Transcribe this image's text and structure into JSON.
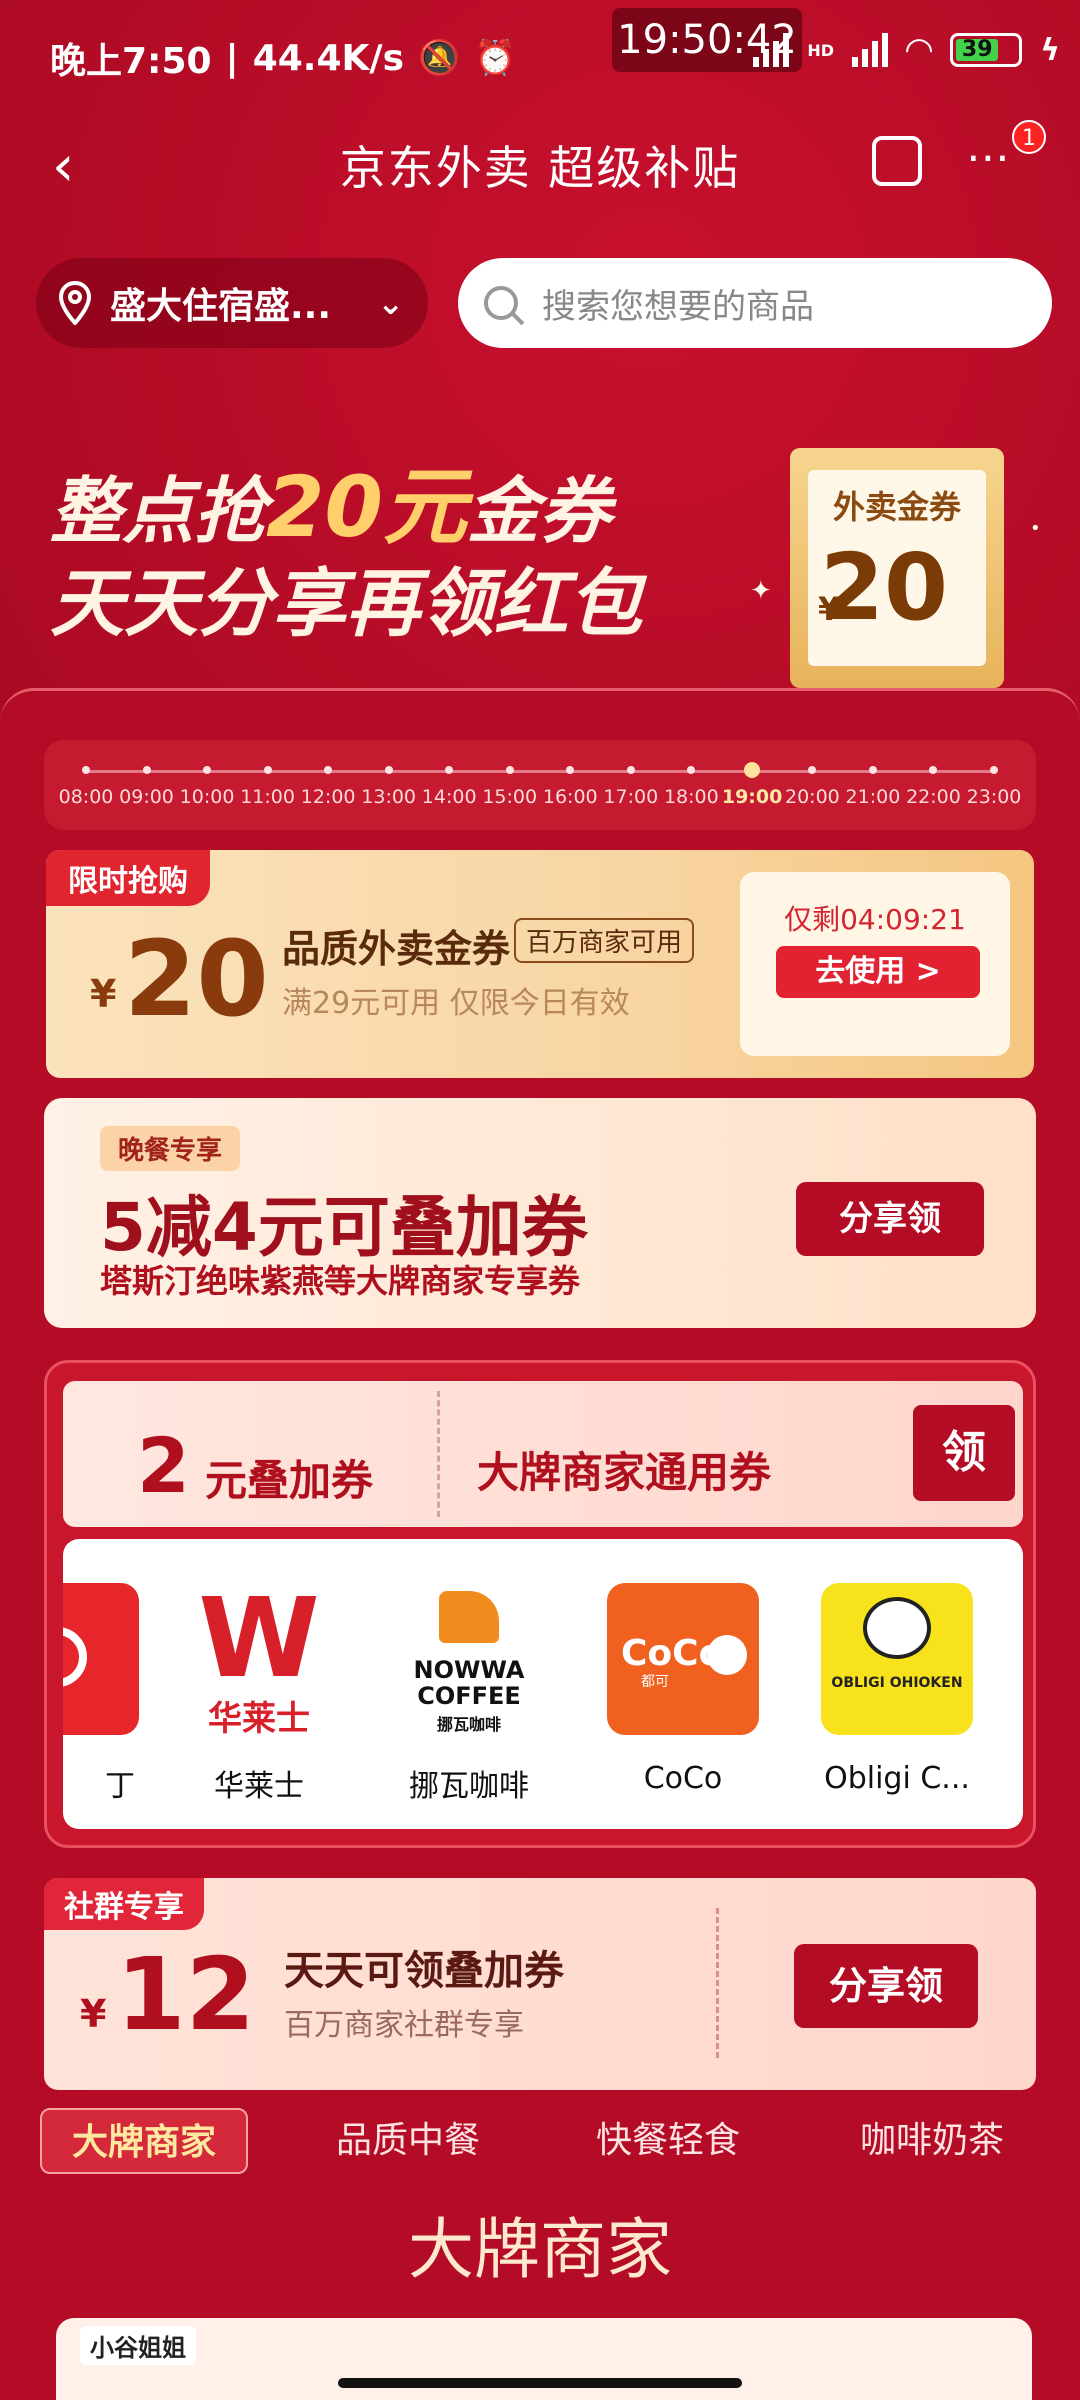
{
  "status_bar": {
    "time_left": "晚上7:50",
    "speed": "44.4K/s",
    "clock": "19:50:42",
    "hd": "HD",
    "battery": "39"
  },
  "nav": {
    "back_icon": "‹",
    "title": "京东外卖 超级补贴",
    "more_icon": "⋯",
    "badge": "1"
  },
  "location": {
    "text": "盛大住宿盛...",
    "chevron": "⌄"
  },
  "search": {
    "placeholder": "搜索您想要的商品"
  },
  "hero": {
    "line1_pre": "整点抢",
    "line1_gold": "20元",
    "line1_post": "金券",
    "line2": "天天分享再领红包",
    "card_title": "外卖金券",
    "card_currency": "¥",
    "card_value": "20"
  },
  "timeline": {
    "ticks": [
      "08:00",
      "09:00",
      "10:00",
      "11:00",
      "12:00",
      "13:00",
      "14:00",
      "15:00",
      "16:00",
      "17:00",
      "18:00",
      "19:00",
      "20:00",
      "21:00",
      "22:00",
      "23:00"
    ],
    "active_index": 11
  },
  "coupon1": {
    "tag": "限时抢购",
    "currency": "¥",
    "value": "20",
    "name": "品质外卖金券",
    "pill": "百万商家可用",
    "condition": "满29元可用 仅限今日有效",
    "remaining": "仅剩04:09:21",
    "use_button": "去使用 >"
  },
  "coupon2": {
    "tag": "晚餐专享",
    "main": "5减4元可叠加券",
    "sub": "塔斯汀绝味紫燕等大牌商家专享券",
    "button": "分享领"
  },
  "stack_coupon": {
    "amount": "2",
    "amount_label": "元叠加券",
    "universal": "大牌商家通用券",
    "button": "领"
  },
  "brands": [
    {
      "name": "丁",
      "icon": "tastien-logo"
    },
    {
      "name": "华莱士",
      "icon": "wallace-logo"
    },
    {
      "name": "挪瓦咖啡",
      "icon": "nowwa-logo"
    },
    {
      "name": "CoCo",
      "icon": "coco-logo"
    },
    {
      "name": "Obligi C...",
      "icon": "obligi-logo"
    }
  ],
  "brand_logo_text": {
    "wallace_cn": "华莱士",
    "nowwa1": "NOWWA",
    "nowwa2": "COFFEE",
    "nowwa3": "挪瓦咖啡",
    "coco": "CoCo",
    "coco_cn": "都可",
    "obligi": "OBLIGI OHIOKEN"
  },
  "coupon3": {
    "tag": "社群专享",
    "currency": "¥",
    "value": "12",
    "title": "天天可领叠加券",
    "subtitle": "百万商家社群专享",
    "button": "分享领"
  },
  "tabs": [
    "大牌商家",
    "品质中餐",
    "快餐轻食",
    "咖啡奶茶"
  ],
  "section_title": "大牌商家",
  "watermark": "小谷姐姐",
  "colors": {
    "background": "#a4081f",
    "gold": "#ffcf6b",
    "accent_red": "#e1252f",
    "button_red": "#b40c25"
  }
}
